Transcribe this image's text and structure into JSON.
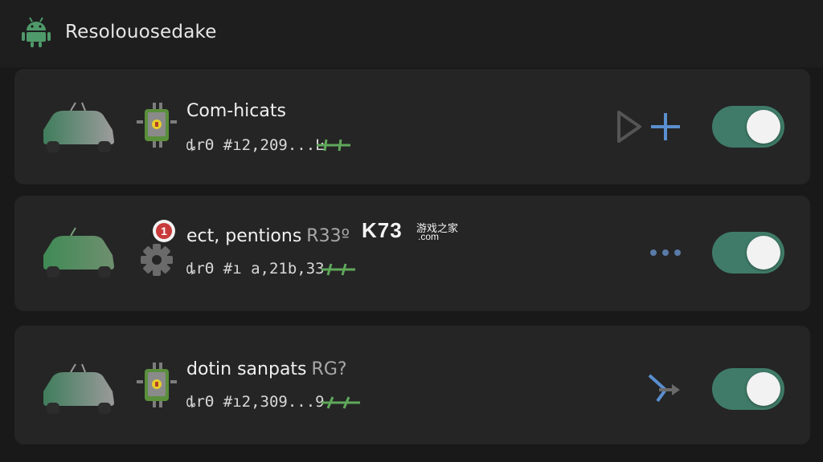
{
  "header": {
    "title": "Resolouosedake",
    "logo_icon": "android-robot-icon"
  },
  "watermark": {
    "main": "K73",
    "sub1": "游戏之家",
    "sub2": ".com"
  },
  "items": [
    {
      "title": "Com-hicats",
      "tag": "",
      "meta": "ȡrΘ #ı2,209...Ŀ",
      "enabled": true,
      "action_icons": [
        "shield-outline-icon",
        "plus-icon"
      ]
    },
    {
      "title": "ect, pentions",
      "tag": "R33º",
      "meta": "ȡrΘ #ı a,21b,33",
      "badge": "1",
      "enabled": true,
      "action_icons": [
        "more-dots-icon"
      ]
    },
    {
      "title": "dotin sanpats",
      "tag": "RG?",
      "meta": "ȡrΘ #ı2,309...9",
      "enabled": true,
      "action_icons": [
        "arrow-icon"
      ]
    }
  ],
  "colors": {
    "accent_green": "#3f7b68",
    "mark_green": "#5fa85a",
    "action_blue": "#5a8fd0"
  }
}
